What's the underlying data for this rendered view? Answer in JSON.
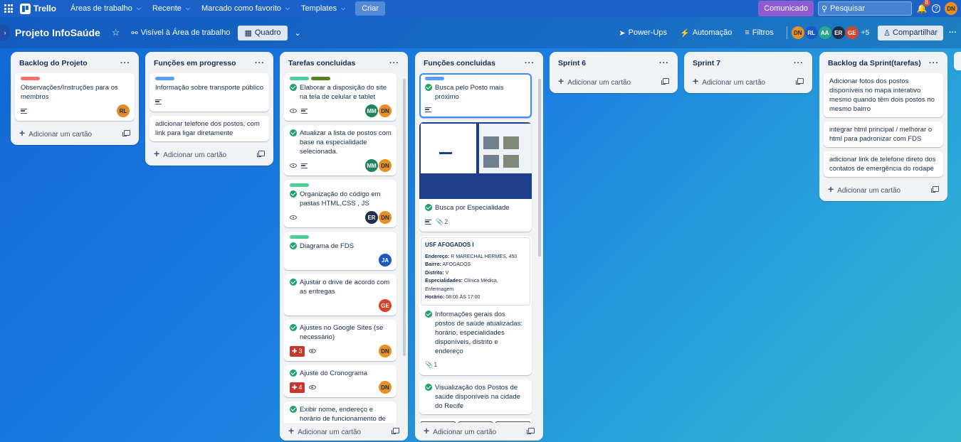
{
  "topbar": {
    "app_name": "Trello",
    "menus": [
      "Áreas de trabalho",
      "Recente",
      "Marcado como favorito",
      "Templates"
    ],
    "create_label": "Criar",
    "comunicado_label": "Comunicado",
    "search_placeholder": "Pesquisar",
    "notifications_count": "8",
    "user_initials": "DN"
  },
  "board": {
    "title": "Projeto InfoSaúde",
    "visibility": "Visível à Área de trabalho",
    "view": "Quadro",
    "powerups": "Power-Ups",
    "automation": "Automação",
    "filters": "Filtros",
    "members": [
      "DN",
      "RL",
      "AA",
      "ER",
      "GE"
    ],
    "members_more": "+5",
    "share": "Compartilhar"
  },
  "lists": {
    "l1": {
      "title": "Backlog do Projeto",
      "cards": [
        {
          "title": "Observações/Instruções para os membros",
          "avatar": "RL"
        }
      ],
      "add": "Adicionar um cartão"
    },
    "l2": {
      "title": "Funções em progresso",
      "cards": [
        {
          "title": "Informação sobre transporte público"
        },
        {
          "title": "adicionar telefone dos postos, com link para ligar diretamente"
        }
      ],
      "add": "Adicionar um cartão"
    },
    "l3": {
      "title": "Tarefas concluidas",
      "cards": [
        {
          "title": "Elaborar a disposição do site na tela de celular e tablet",
          "avatars": [
            "MM",
            "DN"
          ]
        },
        {
          "title": "Atualizar a lista de postos com base na especialidade selecionada.",
          "avatars": [
            "MM",
            "DN"
          ]
        },
        {
          "title": "Organização do código em pastas HTML,CSS , JS",
          "avatars": [
            "ER",
            "DN"
          ]
        },
        {
          "title": "Diagrama de FDS",
          "avatars": [
            "JA"
          ]
        },
        {
          "title": "Ajustar o drive de acordo com as entregas",
          "avatars": [
            "GE"
          ]
        },
        {
          "title": "Ajustes no Google Sites (se necessário)",
          "badge": "3",
          "avatars": [
            "DN"
          ]
        },
        {
          "title": "Ajuste do Cronograma",
          "badge": "4",
          "avatars": [
            "DN"
          ]
        },
        {
          "title": "Exibir nome, endereço e horário de funcionamento de cada posto."
        }
      ],
      "add": "Adicionar um cartão"
    },
    "l4": {
      "title": "Funções concluidas",
      "cards": [
        {
          "title": "Busca pelo Posto mais próximo"
        },
        {
          "title": "Busca por Especialidade",
          "attachments": "2"
        },
        {
          "title": "Informações gerais dos postos de saúde atualizadas: horário, especialidades disponíveis, distrito e endereço",
          "attachments": "1"
        },
        {
          "title": "Visualização dos Postos de saúde disponíveis na cidade do Recife"
        }
      ],
      "usf": {
        "name": "USF AFOGADOS I",
        "endereco_label": "Endereço:",
        "endereco": "R MARECHAL HERMES, 450",
        "bairro_label": "Bairro:",
        "bairro": "AFOGADOS",
        "distrito_label": "Distrito:",
        "distrito": "V",
        "especialidades_label": "Especialidades:",
        "especialidades": "Clínica Médica, Enfermagem",
        "horario_label": "Horário:",
        "horario": "08:00 ÀS 17:00"
      },
      "add": "Adicionar um cartão"
    },
    "l5": {
      "title": "Sprint 6",
      "add": "Adicionar um cartão"
    },
    "l6": {
      "title": "Sprint 7",
      "add": "Adicionar um cartão"
    },
    "l7": {
      "title": "Backlog da Sprint(tarefas)",
      "cards": [
        {
          "title": "Adicionar fotos dos postos disponíveis no mapa interativo mesmo quando têm dois postos no mesmo bairro"
        },
        {
          "title": "integrar html principal / melhorar o html para padronizar com FDS"
        },
        {
          "title": "adicionar link de telefone direto dos contatos de emergência do rodapé"
        }
      ],
      "add": "Adicionar um cartão"
    }
  }
}
